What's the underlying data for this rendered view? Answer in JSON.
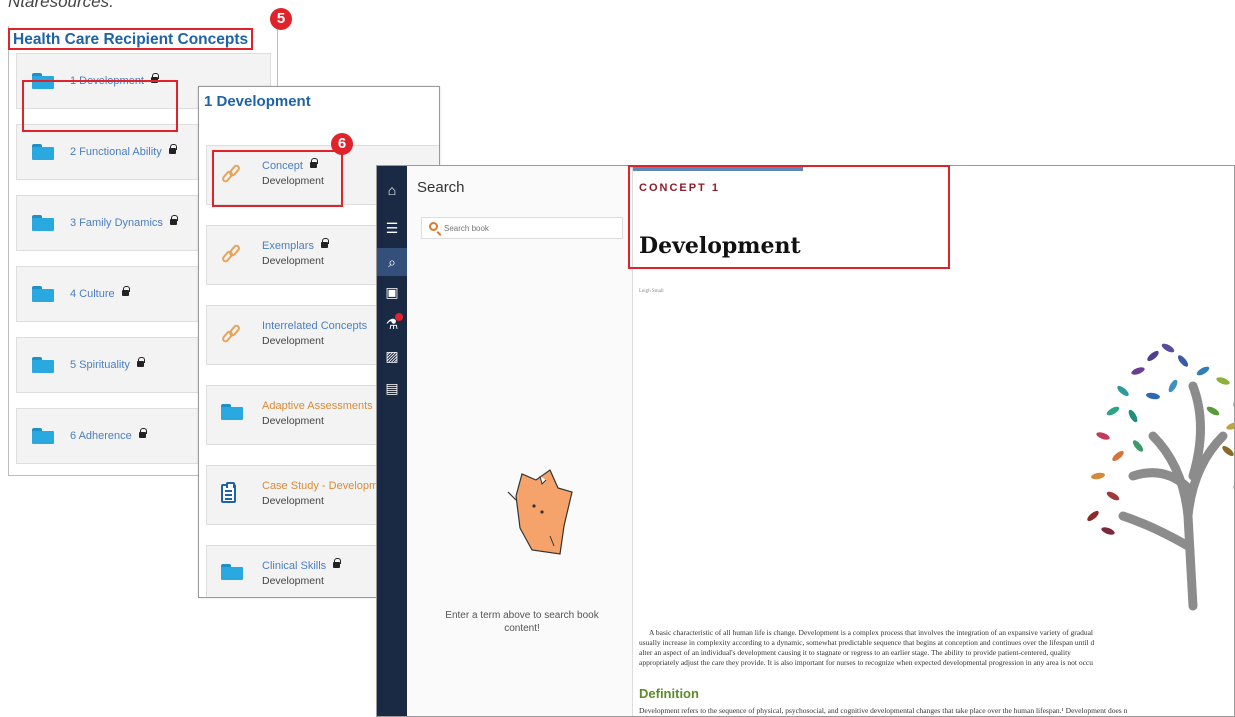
{
  "top_cut_text": "Ntaresources.",
  "markers": {
    "five": "5",
    "six": "6"
  },
  "panel1": {
    "title": "Health Care Recipient Concepts",
    "items": [
      {
        "label": "1 Development"
      },
      {
        "label": "2 Functional Ability"
      },
      {
        "label": "3 Family Dynamics"
      },
      {
        "label": "4 Culture"
      },
      {
        "label": "5 Spirituality"
      },
      {
        "label": "6 Adherence"
      }
    ]
  },
  "panel2": {
    "title": "1 Development",
    "items": [
      {
        "title": "Concept",
        "subtitle": "Development",
        "icon": "link-icon"
      },
      {
        "title": "Exemplars",
        "subtitle": "Development",
        "icon": "link-icon"
      },
      {
        "title": "Interrelated Concepts",
        "subtitle": "Development",
        "icon": "link-icon"
      },
      {
        "title": "Adaptive Assessments",
        "subtitle": "Development",
        "icon": "folder-icon"
      },
      {
        "title": "Case Study - Development",
        "subtitle": "Development",
        "icon": "clipboard-icon"
      },
      {
        "title": "Clinical Skills",
        "subtitle": "Development",
        "icon": "folder-icon"
      }
    ]
  },
  "reader": {
    "sidebar_icons": [
      "home-icon",
      "toc-icon",
      "search-icon",
      "bookmark-icon",
      "flask-icon",
      "image-icon",
      "notes-icon"
    ],
    "search": {
      "title": "Search",
      "placeholder": "Search book",
      "empty_message": "Enter a term above to search book content!"
    },
    "content": {
      "concept_label": "CONCEPT 1",
      "title": "Development",
      "byline": "Leigh Small",
      "paragraph_lines": [
        "A basic characteristic of all human life is change. Development is a complex process that involves the integration of an expansive variety of gradual",
        "usually increase in complexity according to a dynamic, somewhat predictable sequence that begins at conception and continues over the lifespan until d",
        "alter an aspect of an individual's development causing it to stagnate or regress to an earlier stage. The ability to provide patient-centered, quality",
        "appropriately adjust the care they provide. It is also important for nurses to recognize when expected developmental progression in any area is not occu"
      ],
      "section_heading": "Definition",
      "definition_text": "Development refers to the sequence of physical, psychosocial, and cognitive developmental changes that take place over the human lifespan.¹ Development does n"
    }
  },
  "colors": {
    "accent_red": "#e0232b",
    "title_blue": "#1f63a7",
    "link_blue": "#4b7fc1",
    "orange": "#d98b3a",
    "sidebar_navy": "#1b2a44",
    "concept_red": "#8b1d2a",
    "heading_green": "#5d8a2a"
  }
}
